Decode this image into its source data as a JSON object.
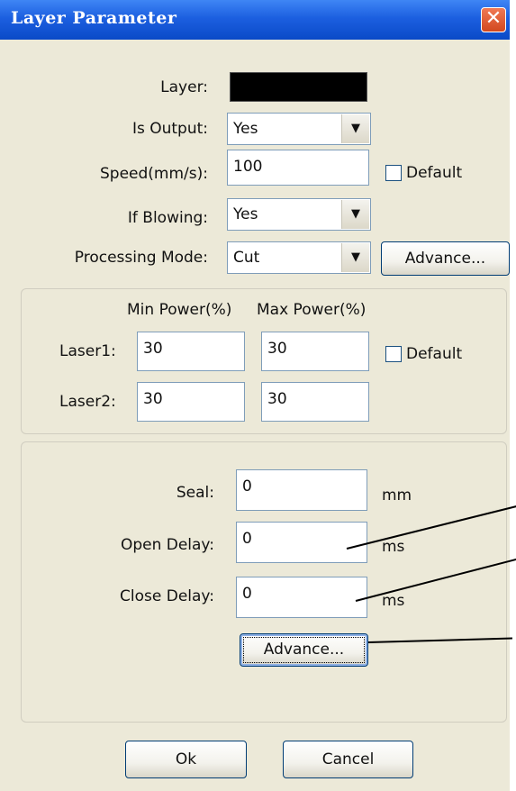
{
  "window": {
    "title": "Layer Parameter",
    "close_glyph": "✕"
  },
  "layer": {
    "label": "Layer:",
    "color": "#000000"
  },
  "is_output": {
    "label": "Is Output:",
    "value": "Yes",
    "arrow_icon": "▼"
  },
  "speed": {
    "label": "Speed(mm/s):",
    "value": "100",
    "default_label": "Default",
    "default_checked": false
  },
  "if_blowing": {
    "label": "If Blowing:",
    "value": "Yes",
    "arrow_icon": "▼"
  },
  "processing_mode": {
    "label": "Processing Mode:",
    "value": "Cut",
    "arrow_icon": "▼",
    "advance_label": "Advance..."
  },
  "power": {
    "min_header": "Min Power(%)",
    "max_header": "Max Power(%)",
    "laser1_label": "Laser1:",
    "laser1_min": "30",
    "laser1_max": "30",
    "laser2_label": "Laser2:",
    "laser2_min": "30",
    "laser2_max": "30",
    "default_label": "Default",
    "default_checked": false
  },
  "seal": {
    "label": "Seal:",
    "value": "0",
    "unit": "mm"
  },
  "open_delay": {
    "label": "Open Delay:",
    "value": "0",
    "unit": "ms"
  },
  "close_delay": {
    "label": "Close Delay:",
    "value": "0",
    "unit": "ms"
  },
  "delay_advance_label": "Advance...",
  "footer": {
    "ok_label": "Ok",
    "cancel_label": "Cancel"
  }
}
